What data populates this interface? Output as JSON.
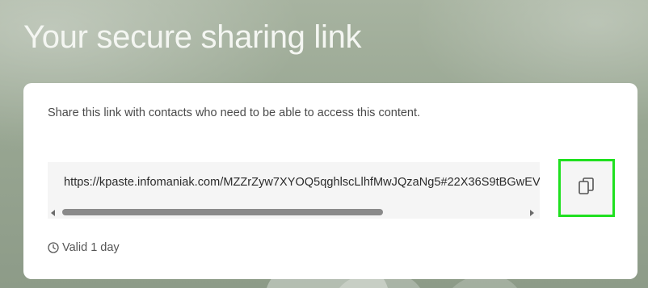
{
  "page": {
    "title": "Your secure sharing link"
  },
  "card": {
    "description": "Share this link with contacts who need to be able to access this content.",
    "link": "https://kpaste.infomaniak.com/MZZrZyw7XYOQ5qghlscLlhfMwJQzaNg5#22X36S9tBGwEV",
    "validity": "Valid 1 day"
  },
  "icons": {
    "copy": "copy-icon",
    "clock": "clock-icon"
  },
  "colors": {
    "highlight": "#1fe01f",
    "card_background": "#ffffff",
    "link_background": "#f5f5f5"
  }
}
